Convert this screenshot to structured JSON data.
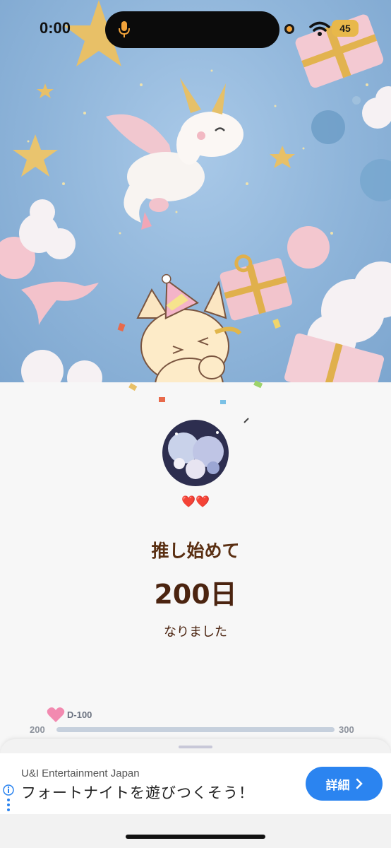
{
  "status_bar": {
    "time": "0:00",
    "battery": "45",
    "icons": [
      "mic-icon",
      "wifi-icon",
      "battery-icon"
    ]
  },
  "hero": {
    "icons": [
      "unicorn-dragon-illustration",
      "cat-mascot-icon",
      "party-hat-icon",
      "gift-box-icon",
      "star-icon",
      "cloud-icon",
      "confetti-icon"
    ]
  },
  "main": {
    "hearts": "❤️❤️",
    "line1": "推し始めて",
    "line2": "200日",
    "line3": "なりました"
  },
  "progress": {
    "label": "D-100",
    "start": "200",
    "end": "300",
    "fraction": 0.0,
    "colors": {
      "track": "#c6d0dd",
      "heart": "#f28ab0"
    }
  },
  "ad": {
    "advertiser": "U&I Entertainment Japan",
    "headline": "フォートナイトを遊びつくそう！",
    "button_label": "詳細",
    "button_color": "#2b84f0"
  }
}
